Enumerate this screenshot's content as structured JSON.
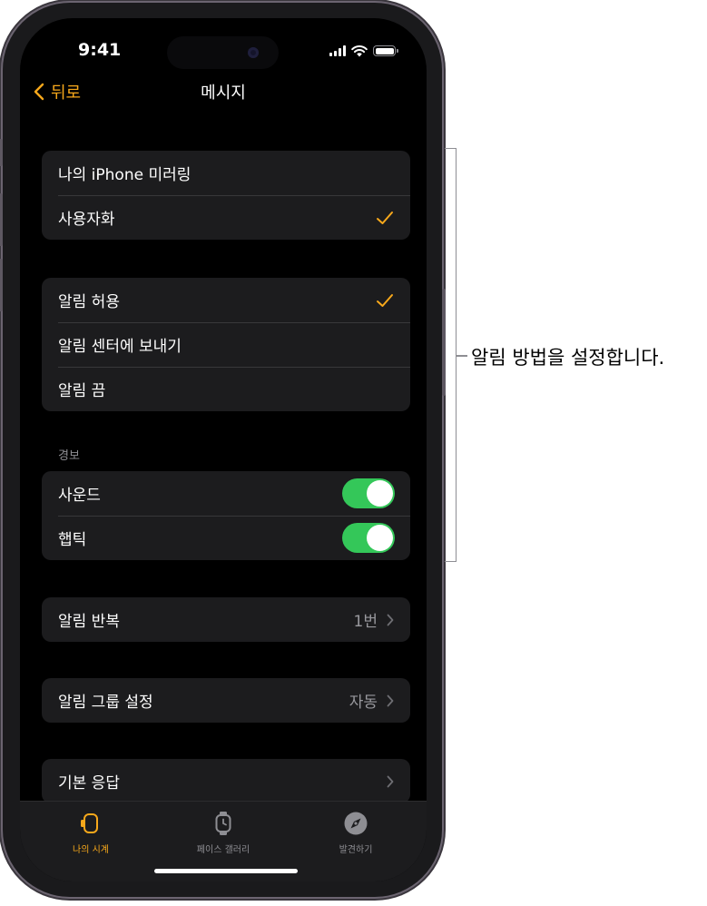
{
  "status_bar": {
    "time": "9:41"
  },
  "nav": {
    "back_label": "뒤로",
    "title": "메시지"
  },
  "group1": {
    "items": [
      {
        "label": "나의 iPhone 미러링",
        "checked": false
      },
      {
        "label": "사용자화",
        "checked": true
      }
    ]
  },
  "group2": {
    "items": [
      {
        "label": "알림 허용",
        "checked": true
      },
      {
        "label": "알림 센터에 보내기",
        "checked": false
      },
      {
        "label": "알림 끔",
        "checked": false
      }
    ]
  },
  "alerts": {
    "header": "경보",
    "items": [
      {
        "label": "사운드",
        "on": true
      },
      {
        "label": "햅틱",
        "on": true
      }
    ]
  },
  "repeat": {
    "label": "알림 반복",
    "value": "1번"
  },
  "grouping": {
    "label": "알림 그룹 설정",
    "value": "자동"
  },
  "default_replies": {
    "label": "기본 응답"
  },
  "tabbar": {
    "tabs": [
      {
        "label": "나의 시계",
        "icon": "watch-outline-icon",
        "active": true
      },
      {
        "label": "페이스 갤러리",
        "icon": "watch-face-icon",
        "active": false
      },
      {
        "label": "발견하기",
        "icon": "compass-icon",
        "active": false
      }
    ]
  },
  "callout": {
    "text": "알림 방법을 설정합니다."
  },
  "colors": {
    "accent": "#f7a81b",
    "toggle_on": "#34c759",
    "cell_bg": "#1c1c1e",
    "screen_bg": "#000000"
  }
}
